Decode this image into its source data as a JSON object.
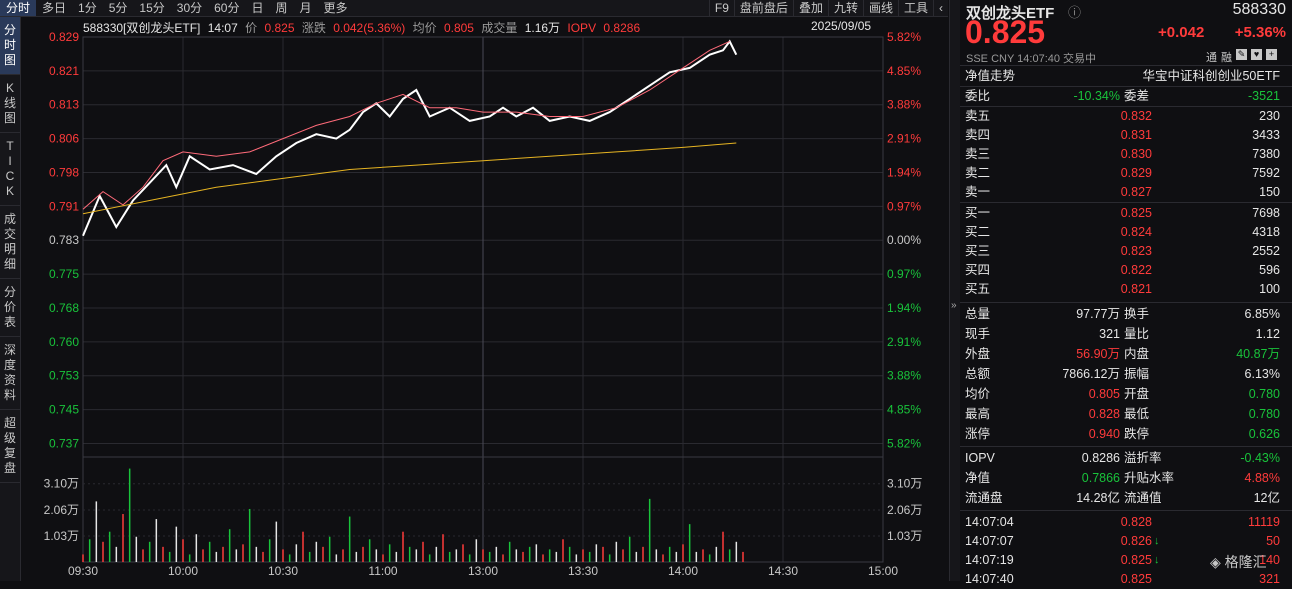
{
  "toolbar": {
    "tabs": [
      "分时",
      "多日",
      "1分",
      "5分",
      "15分",
      "30分",
      "60分",
      "日",
      "周",
      "月",
      "更多"
    ],
    "right_tabs": [
      "F9",
      "盘前盘后",
      "叠加",
      "九转",
      "画线",
      "工具"
    ],
    "collapse_icon": "chevron-left-icon"
  },
  "leftnav": [
    "分时图",
    "K线图",
    "TICK",
    "成交明细",
    "分价表",
    "深度资料",
    "超级复盘"
  ],
  "chart_info": {
    "code_name": "588330[双创龙头ETF]",
    "time": "14:07",
    "price_label": "价",
    "price": "0.825",
    "change_label": "涨跌",
    "change": "0.042(5.36%)",
    "avg_label": "均价",
    "avg": "0.805",
    "vol_label": "成交量",
    "vol": "1.16万",
    "iopv_label": "IOPV",
    "iopv": "0.8286",
    "date": "2025/09/05"
  },
  "chart_data": {
    "type": "line",
    "y_ticks_left": [
      "0.829",
      "0.821",
      "0.813",
      "0.806",
      "0.798",
      "0.791",
      "0.783",
      "0.775",
      "0.768",
      "0.760",
      "0.753",
      "0.745",
      "0.737"
    ],
    "y_ticks_right": [
      "5.82%",
      "4.85%",
      "3.88%",
      "2.91%",
      "1.94%",
      "0.97%",
      "0.00%",
      "0.97%",
      "1.94%",
      "2.91%",
      "3.88%",
      "4.85%",
      "5.82%"
    ],
    "vol_ticks": [
      "3.10万",
      "2.06万",
      "1.03万"
    ],
    "x_ticks": [
      "09:30",
      "10:00",
      "10:30",
      "11:00",
      "13:00",
      "13:30",
      "14:00",
      "14:30",
      "15:00"
    ],
    "price_range": [
      0.737,
      0.829
    ],
    "prev_close": 0.783,
    "series": [
      {
        "name": "价",
        "points": [
          [
            0,
            0.784
          ],
          [
            5,
            0.793
          ],
          [
            10,
            0.786
          ],
          [
            15,
            0.792
          ],
          [
            20,
            0.796
          ],
          [
            25,
            0.8
          ],
          [
            28,
            0.795
          ],
          [
            32,
            0.802
          ],
          [
            38,
            0.799
          ],
          [
            45,
            0.8
          ],
          [
            52,
            0.798
          ],
          [
            58,
            0.802
          ],
          [
            64,
            0.805
          ],
          [
            70,
            0.807
          ],
          [
            76,
            0.806
          ],
          [
            80,
            0.808
          ],
          [
            84,
            0.812
          ],
          [
            88,
            0.814
          ],
          [
            92,
            0.811
          ],
          [
            96,
            0.815
          ],
          [
            100,
            0.817
          ],
          [
            104,
            0.811
          ],
          [
            110,
            0.813
          ],
          [
            116,
            0.81
          ],
          [
            122,
            0.811
          ],
          [
            126,
            0.813
          ],
          [
            130,
            0.811
          ],
          [
            135,
            0.813
          ],
          [
            140,
            0.81
          ],
          [
            146,
            0.811
          ],
          [
            152,
            0.81
          ],
          [
            158,
            0.812
          ],
          [
            164,
            0.815
          ],
          [
            170,
            0.818
          ],
          [
            176,
            0.821
          ],
          [
            182,
            0.822
          ],
          [
            188,
            0.825
          ],
          [
            192,
            0.826
          ],
          [
            194,
            0.828
          ],
          [
            196,
            0.825
          ]
        ]
      },
      {
        "name": "IOPV",
        "points": [
          [
            0,
            0.79
          ],
          [
            6,
            0.794
          ],
          [
            12,
            0.791
          ],
          [
            18,
            0.795
          ],
          [
            24,
            0.801
          ],
          [
            30,
            0.803
          ],
          [
            40,
            0.802
          ],
          [
            50,
            0.803
          ],
          [
            60,
            0.806
          ],
          [
            70,
            0.809
          ],
          [
            80,
            0.811
          ],
          [
            88,
            0.814
          ],
          [
            96,
            0.816
          ],
          [
            104,
            0.813
          ],
          [
            112,
            0.813
          ],
          [
            120,
            0.812
          ],
          [
            130,
            0.812
          ],
          [
            140,
            0.811
          ],
          [
            150,
            0.811
          ],
          [
            160,
            0.813
          ],
          [
            170,
            0.817
          ],
          [
            180,
            0.822
          ],
          [
            188,
            0.826
          ],
          [
            194,
            0.828
          ]
        ]
      },
      {
        "name": "均价",
        "points": [
          [
            0,
            0.789
          ],
          [
            20,
            0.792
          ],
          [
            40,
            0.795
          ],
          [
            60,
            0.797
          ],
          [
            80,
            0.799
          ],
          [
            100,
            0.8
          ],
          [
            120,
            0.801
          ],
          [
            140,
            0.802
          ],
          [
            160,
            0.803
          ],
          [
            180,
            0.804
          ],
          [
            196,
            0.805
          ]
        ]
      }
    ],
    "volume": [
      0.3,
      0.9,
      2.4,
      0.8,
      1.2,
      0.6,
      1.9,
      3.7,
      1.0,
      0.5,
      0.8,
      1.7,
      0.6,
      0.4,
      1.4,
      0.9,
      0.3,
      1.1,
      0.5,
      0.8,
      0.4,
      0.6,
      1.3,
      0.5,
      0.7,
      2.1,
      0.6,
      0.4,
      0.9,
      1.6,
      0.5,
      0.3,
      0.7,
      1.2,
      0.4,
      0.8,
      0.6,
      1.0,
      0.3,
      0.5,
      1.8,
      0.4,
      0.6,
      0.9,
      0.5,
      0.3,
      0.7,
      0.4,
      1.2,
      0.6,
      0.5,
      0.8,
      0.3,
      0.6,
      1.1,
      0.4,
      0.5,
      0.7,
      0.3,
      0.9,
      0.5,
      0.4,
      0.6,
      0.3,
      0.8,
      0.5,
      0.4,
      0.6,
      0.7,
      0.3,
      0.5,
      0.4,
      0.9,
      0.6,
      0.3,
      0.5,
      0.4,
      0.7,
      0.6,
      0.3,
      0.8,
      0.5,
      1.0,
      0.4,
      0.6,
      2.5,
      0.5,
      0.3,
      0.6,
      0.4,
      0.7,
      1.5,
      0.4,
      0.5,
      0.3,
      0.6,
      1.2,
      0.5,
      0.8,
      0.4
    ],
    "title": "",
    "xlabel": "",
    "ylabel": ""
  },
  "panel": {
    "name": "双创龙头ETF",
    "code": "588330",
    "price": "0.825",
    "change": "+0.042",
    "pct": "+5.36%",
    "exchange": "SSE",
    "currency": "CNY",
    "time": "14:07:40",
    "status": "交易中",
    "badges": [
      "通",
      "融"
    ],
    "netvalue_label": "净值走势",
    "index_name": "华宝中证科创创业50ETF",
    "weibi_label": "委比",
    "weibi": "-10.34%",
    "weicha_label": "委差",
    "weicha": "-3521",
    "asks": [
      {
        "label": "卖五",
        "price": "0.832",
        "vol": "230"
      },
      {
        "label": "卖四",
        "price": "0.831",
        "vol": "3433"
      },
      {
        "label": "卖三",
        "price": "0.830",
        "vol": "7380"
      },
      {
        "label": "卖二",
        "price": "0.829",
        "vol": "7592"
      },
      {
        "label": "卖一",
        "price": "0.827",
        "vol": "150"
      }
    ],
    "bids": [
      {
        "label": "买一",
        "price": "0.825",
        "vol": "7698"
      },
      {
        "label": "买二",
        "price": "0.824",
        "vol": "4318"
      },
      {
        "label": "买三",
        "price": "0.823",
        "vol": "2552"
      },
      {
        "label": "买四",
        "price": "0.822",
        "vol": "596"
      },
      {
        "label": "买五",
        "price": "0.821",
        "vol": "100"
      }
    ],
    "stats": [
      {
        "l1": "总量",
        "v1": "97.77万",
        "c1": "white",
        "l2": "换手",
        "v2": "6.85%",
        "c2": "white"
      },
      {
        "l1": "现手",
        "v1": "321",
        "c1": "white",
        "l2": "量比",
        "v2": "1.12",
        "c2": "white"
      },
      {
        "l1": "外盘",
        "v1": "56.90万",
        "c1": "red",
        "l2": "内盘",
        "v2": "40.87万",
        "c2": "green"
      },
      {
        "l1": "总额",
        "v1": "7866.12万",
        "c1": "white",
        "l2": "振幅",
        "v2": "6.13%",
        "c2": "white"
      },
      {
        "l1": "均价",
        "v1": "0.805",
        "c1": "red",
        "l2": "开盘",
        "v2": "0.780",
        "c2": "green"
      },
      {
        "l1": "最高",
        "v1": "0.828",
        "c1": "red",
        "l2": "最低",
        "v2": "0.780",
        "c2": "green"
      },
      {
        "l1": "涨停",
        "v1": "0.940",
        "c1": "red",
        "l2": "跌停",
        "v2": "0.626",
        "c2": "green"
      }
    ],
    "stats2": [
      {
        "l1": "IOPV",
        "v1": "0.8286",
        "c1": "white",
        "l2": "溢折率",
        "v2": "-0.43%",
        "c2": "green"
      },
      {
        "l1": "净值",
        "v1": "0.7866",
        "c1": "green",
        "l2": "升贴水率",
        "v2": "4.88%",
        "c2": "red"
      },
      {
        "l1": "流通盘",
        "v1": "14.28亿",
        "c1": "white",
        "l2": "流通值",
        "v2": "12亿",
        "c2": "white"
      }
    ],
    "ticks": [
      {
        "time": "14:07:04",
        "price": "0.828",
        "vol": "11119",
        "dir": ""
      },
      {
        "time": "14:07:07",
        "price": "0.826",
        "vol": "50",
        "dir": "down"
      },
      {
        "time": "14:07:19",
        "price": "0.825",
        "vol": "140",
        "dir": "down"
      },
      {
        "time": "14:07:40",
        "price": "0.825",
        "vol": "321",
        "dir": ""
      }
    ],
    "watermark": "格隆汇"
  },
  "colors": {
    "up": "#ff3b3b",
    "down": "#19c33b",
    "price_line": "#ffffff",
    "iopv_line": "#ff6b7a",
    "avg_line": "#e6b422",
    "grid": "#2a2a30"
  }
}
